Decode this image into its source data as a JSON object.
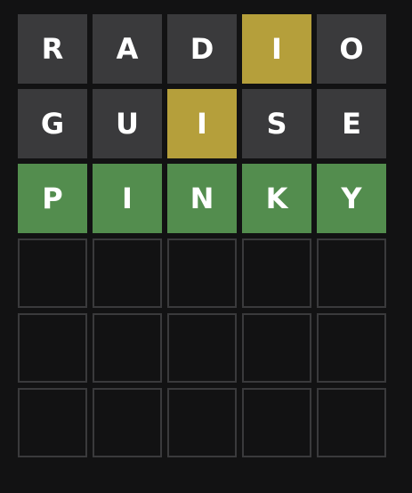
{
  "colors": {
    "background": "#121213",
    "absent": "#3a3a3c",
    "present": "#b59f3b",
    "correct": "#538d4e",
    "empty_border": "#3a3a3c",
    "letter": "#ffffff"
  },
  "board": {
    "rows": [
      {
        "tiles": [
          {
            "letter": "R",
            "state": "absent"
          },
          {
            "letter": "A",
            "state": "absent"
          },
          {
            "letter": "D",
            "state": "absent"
          },
          {
            "letter": "I",
            "state": "present"
          },
          {
            "letter": "O",
            "state": "absent"
          }
        ]
      },
      {
        "tiles": [
          {
            "letter": "G",
            "state": "absent"
          },
          {
            "letter": "U",
            "state": "absent"
          },
          {
            "letter": "I",
            "state": "present"
          },
          {
            "letter": "S",
            "state": "absent"
          },
          {
            "letter": "E",
            "state": "absent"
          }
        ]
      },
      {
        "tiles": [
          {
            "letter": "P",
            "state": "correct"
          },
          {
            "letter": "I",
            "state": "correct"
          },
          {
            "letter": "N",
            "state": "correct"
          },
          {
            "letter": "K",
            "state": "correct"
          },
          {
            "letter": "Y",
            "state": "correct"
          }
        ]
      },
      {
        "tiles": [
          {
            "letter": "",
            "state": "empty"
          },
          {
            "letter": "",
            "state": "empty"
          },
          {
            "letter": "",
            "state": "empty"
          },
          {
            "letter": "",
            "state": "empty"
          },
          {
            "letter": "",
            "state": "empty"
          }
        ]
      },
      {
        "tiles": [
          {
            "letter": "",
            "state": "empty"
          },
          {
            "letter": "",
            "state": "empty"
          },
          {
            "letter": "",
            "state": "empty"
          },
          {
            "letter": "",
            "state": "empty"
          },
          {
            "letter": "",
            "state": "empty"
          }
        ]
      },
      {
        "tiles": [
          {
            "letter": "",
            "state": "empty"
          },
          {
            "letter": "",
            "state": "empty"
          },
          {
            "letter": "",
            "state": "empty"
          },
          {
            "letter": "",
            "state": "empty"
          },
          {
            "letter": "",
            "state": "empty"
          }
        ]
      }
    ]
  }
}
